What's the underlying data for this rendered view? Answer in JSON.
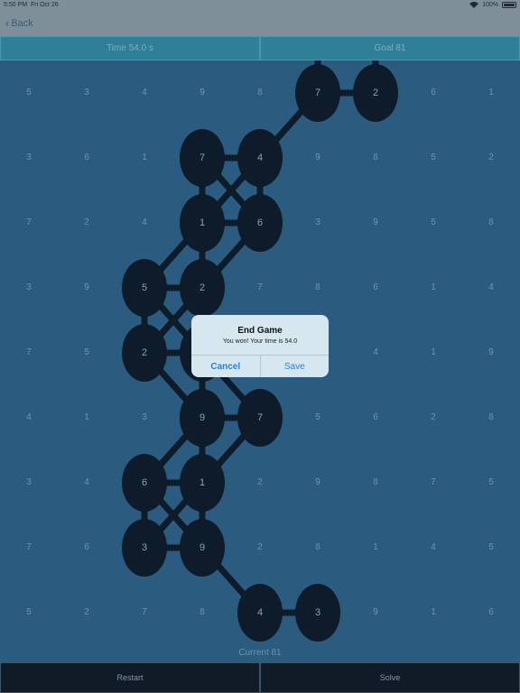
{
  "status_bar": {
    "time": "5:50 PM",
    "date": "Fri Oct 26",
    "battery": "100%"
  },
  "nav": {
    "back_label": "Back"
  },
  "header": {
    "time_label": "Time  54.0 s",
    "goal_label": "Goal  81"
  },
  "board": {
    "cols": 9,
    "rows": 9,
    "grid": [
      [
        "5",
        "3",
        "4",
        "9",
        "8",
        "7",
        "2",
        "6",
        "1"
      ],
      [
        "3",
        "6",
        "1",
        "7",
        "4",
        "9",
        "8",
        "5",
        "2"
      ],
      [
        "7",
        "2",
        "4",
        "1",
        "6",
        "3",
        "9",
        "5",
        "8"
      ],
      [
        "3",
        "9",
        "5",
        "2",
        "7",
        "8",
        "6",
        "1",
        "4"
      ],
      [
        "7",
        "5",
        "2",
        "",
        "",
        "",
        "4",
        "1",
        "9"
      ],
      [
        "4",
        "1",
        "3",
        "9",
        "7",
        "5",
        "6",
        "2",
        "8"
      ],
      [
        "3",
        "4",
        "6",
        "1",
        "2",
        "9",
        "8",
        "7",
        "5"
      ],
      [
        "7",
        "6",
        "3",
        "9",
        "2",
        "8",
        "1",
        "4",
        "5"
      ],
      [
        "5",
        "2",
        "7",
        "8",
        "4",
        "3",
        "9",
        "1",
        "6"
      ]
    ],
    "selected": [
      [
        0,
        5
      ],
      [
        0,
        6
      ],
      [
        1,
        3
      ],
      [
        1,
        4
      ],
      [
        2,
        3
      ],
      [
        2,
        4
      ],
      [
        3,
        2
      ],
      [
        3,
        3
      ],
      [
        4,
        2
      ],
      [
        4,
        3
      ],
      [
        5,
        3
      ],
      [
        5,
        4
      ],
      [
        6,
        2
      ],
      [
        6,
        3
      ],
      [
        7,
        2
      ],
      [
        7,
        3
      ],
      [
        8,
        4
      ],
      [
        8,
        5
      ]
    ],
    "colors": {
      "background": "#2b5c80",
      "tile": "#0d1b2a",
      "path": "#0d1b2a"
    }
  },
  "footer": {
    "current_label": "Current  81"
  },
  "buttons": {
    "restart": "Restart",
    "solve": "Solve"
  },
  "alert": {
    "title": "End Game",
    "message": "You won! Your time is 54.0",
    "cancel": "Cancel",
    "save": "Save"
  }
}
